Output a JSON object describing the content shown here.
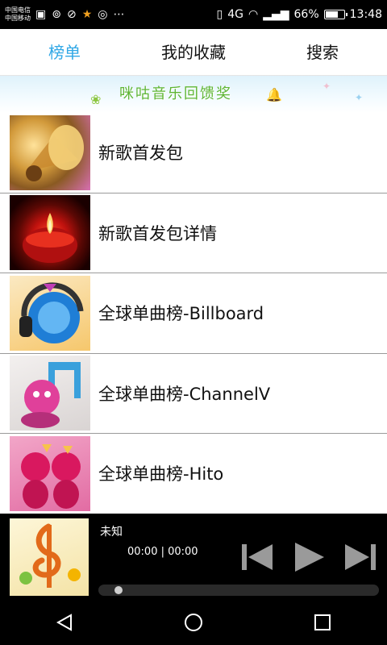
{
  "status_bar": {
    "carrier_1": "中国电信",
    "carrier_2": "中国移动",
    "network": "4G",
    "battery": "66%",
    "time": "13:48"
  },
  "tabs": [
    {
      "label": "榜单",
      "active": true
    },
    {
      "label": "我的收藏",
      "active": false
    },
    {
      "label": "搜索",
      "active": false
    }
  ],
  "banner": {
    "text": "咪咕音乐回馈奖"
  },
  "list": [
    {
      "label": "新歌首发包"
    },
    {
      "label": "新歌首发包详情"
    },
    {
      "label": "全球单曲榜-Billboard"
    },
    {
      "label": "全球单曲榜-ChannelV"
    },
    {
      "label": "全球单曲榜-Hito"
    }
  ],
  "player": {
    "song_title": "未知",
    "time": "00:00 | 00:00",
    "progress": 0
  },
  "colors": {
    "accent": "#31a8e6",
    "background": "#ffffff",
    "bars": "#000000"
  }
}
